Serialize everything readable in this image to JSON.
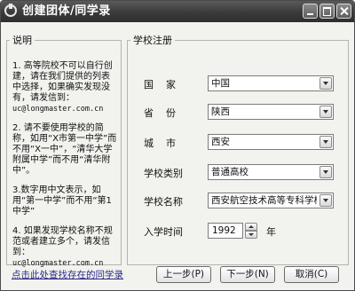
{
  "window": {
    "title": "创建团体/同学录"
  },
  "info": {
    "legend": "说明",
    "paragraphs": [
      "1. 高等院校不可以自行创建，请在我们提供的列表中选择，如果确实发现没有，请发信到：",
      "2. 请不要使用学校的简称，如用“X市第一中学”而不用“X一中”，“清华大学附属中学”而不用“清华附中”。",
      "3.数字用中文表示，如用“第一中学”而不用“第1中学”",
      "4. 如果发现学校名称不规范或者建立多个，请发信到："
    ],
    "email_1": "uc@longmaster.com.cn",
    "email_4": "uc@longmaster.com.cn"
  },
  "form": {
    "legend": "学校注册",
    "country_label": "国    家",
    "country_value": "中国",
    "province_label": "省    份",
    "province_value": "陕西",
    "city_label": "城    市",
    "city_value": "西安",
    "school_type_label": "学校类别",
    "school_type_value": "普通高校",
    "school_name_label": "学校名称",
    "school_name_value": "西安航空技术高等专科学校",
    "enroll_label": "入学时间",
    "enroll_year": "1992",
    "enroll_unit": "年"
  },
  "footer": {
    "find_link": "点击此处查找存在的同学录",
    "prev_label": "上一步(P)",
    "next_label": "下一步(N)",
    "cancel_label": "取消(C)"
  }
}
